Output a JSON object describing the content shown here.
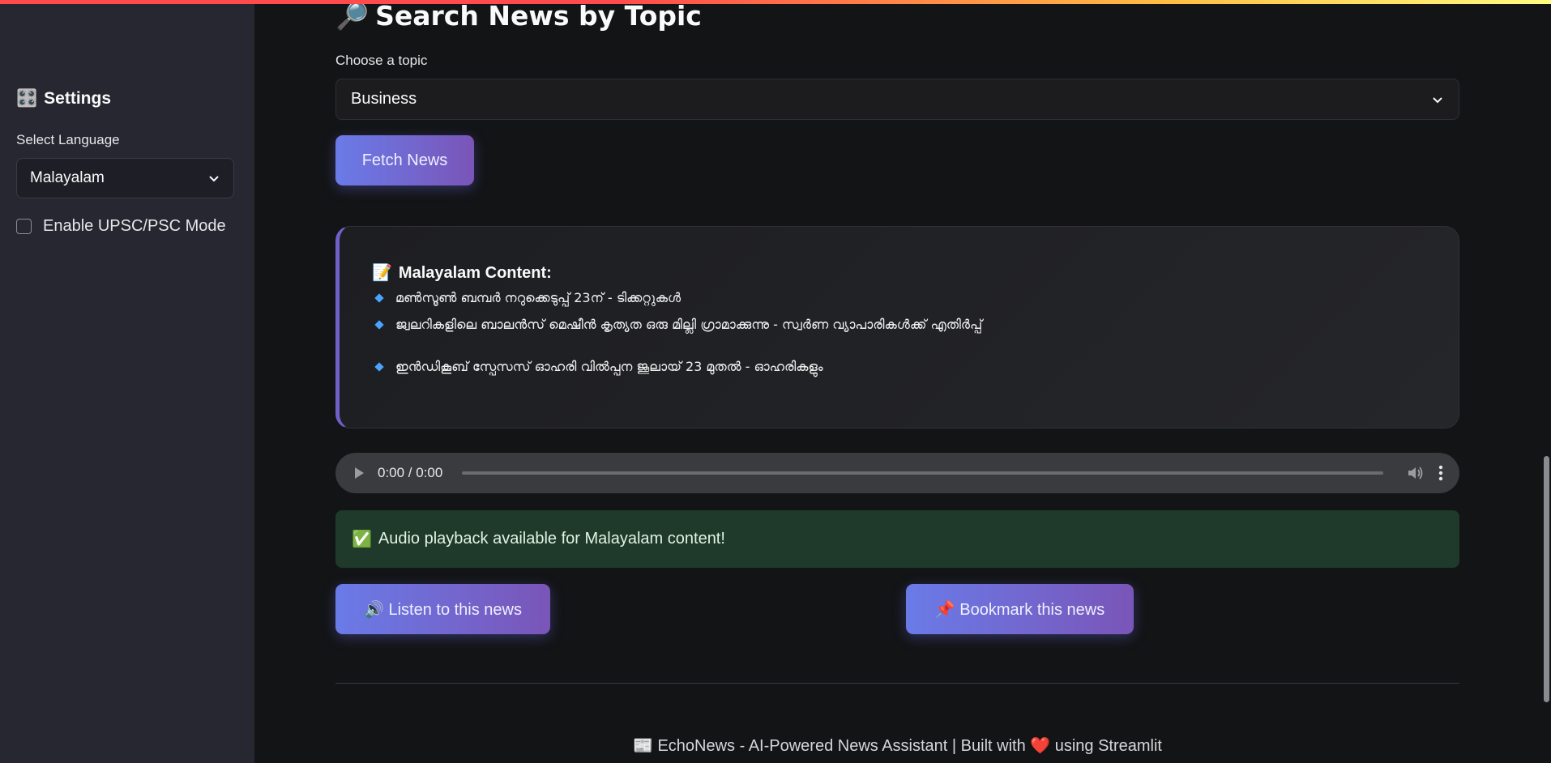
{
  "sidebar": {
    "title_icon": "🎛️",
    "title": "Settings",
    "language_label": "Select Language",
    "language_value": "Malayalam",
    "upsc_label": "Enable UPSC/PSC Mode",
    "upsc_checked": false
  },
  "main": {
    "title_icon": "🔎",
    "title": "Search News by Topic",
    "topic_label": "Choose a topic",
    "topic_value": "Business",
    "fetch_button": "Fetch News",
    "content_card": {
      "heading_icon": "📝",
      "heading": "Malayalam Content:",
      "items": [
        "മൺസൂൺ ബമ്പർ നറുക്കെടുപ്പ് 23ന് - ടിക്കറ്റുകൾ",
        "ജ്വലറികളിലെ ബാലൻസ് മെഷീൻ കൃത്യത ഒരു മില്ലി ഗ്രാമാക്കുന്നു - സ്വർണ വ്യാപാരികൾക്ക് എതിർപ്പ്",
        "ഇൻഡികൂബ് സ്പേസസ് ഓഹരി വിൽപ്പന ജൂലായ് 23 മുതൽ - ഓഹരികളും"
      ]
    },
    "audio": {
      "time": "0:00 / 0:00",
      "progress": 0
    },
    "success_icon": "✅",
    "success_message": "Audio playback available for Malayalam content!",
    "listen_button": "🔊 Listen to this news",
    "bookmark_button": "📌 Bookmark this news",
    "footer": "📰 EchoNews - AI-Powered News Assistant | Built with ❤️ using Streamlit"
  },
  "colors": {
    "accent_gradient_start": "#6a7be8",
    "accent_gradient_end": "#7a55b8",
    "success_bg": "#1f3a2a",
    "sidebar_bg": "#262730"
  }
}
